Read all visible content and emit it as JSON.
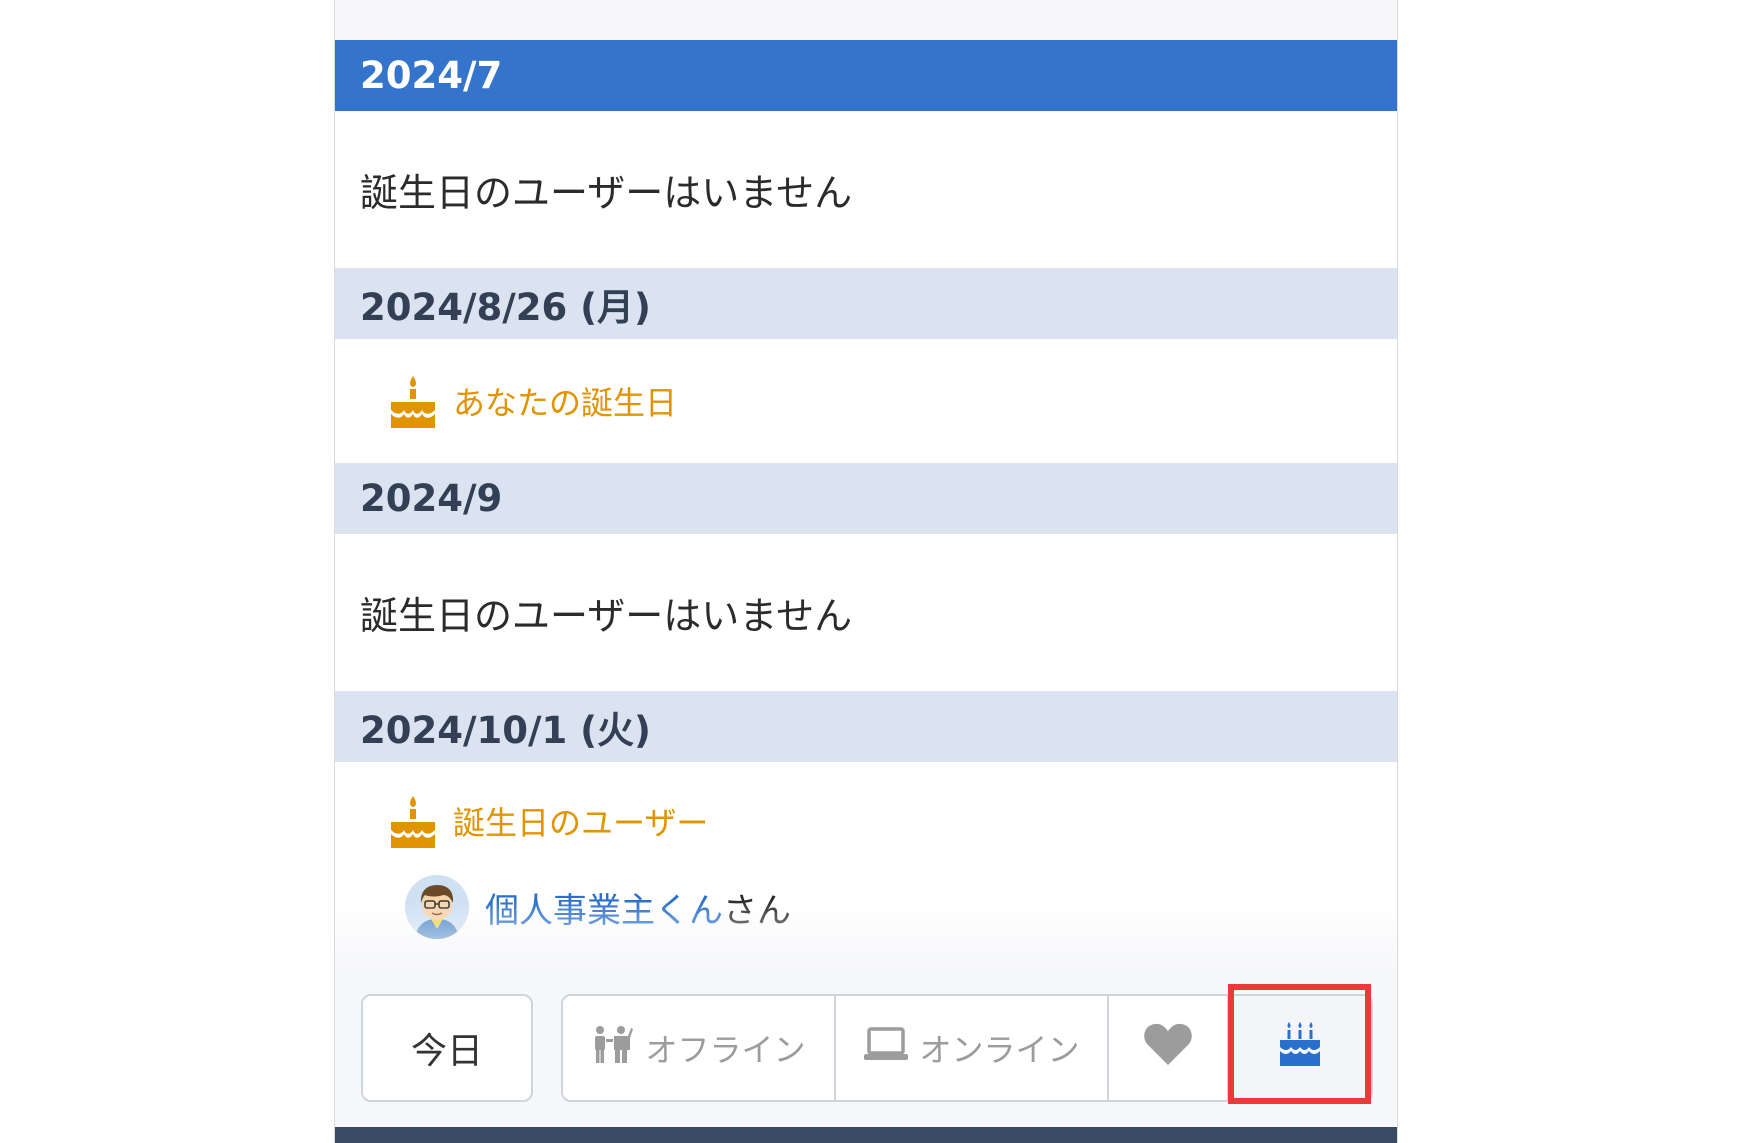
{
  "sections": {
    "july": {
      "header": "2024/7",
      "empty_text": "誕生日のユーザーはいません"
    },
    "aug26": {
      "header": "2024/8/26 (月)",
      "birthday_text": "あなたの誕生日"
    },
    "sep": {
      "header": "2024/9",
      "empty_text": "誕生日のユーザーはいません"
    },
    "oct1": {
      "header": "2024/10/1 (火)",
      "birthday_heading": "誕生日のユーザー",
      "user_name": "個人事業主くん",
      "user_suffix": "さん"
    }
  },
  "toolbar": {
    "today_label": "今日",
    "offline_label": "オフライン",
    "online_label": "オンライン"
  },
  "icons": {
    "offline": "people-icon",
    "online": "laptop-icon",
    "favorite": "heart-icon",
    "birthday": "birthday-cake-icon",
    "cake": "cake-icon"
  },
  "colors": {
    "month_header": "#3574cd",
    "date_header": "#dbe3f0",
    "birthday_accent": "#e09400",
    "link": "#2a6fcb",
    "highlight": "#ea3a3a"
  }
}
